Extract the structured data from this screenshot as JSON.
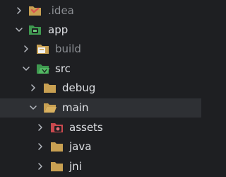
{
  "tree": {
    "items": [
      {
        "label": ".idea",
        "icon": "settings-folder-icon",
        "expanded": false,
        "muted": true
      },
      {
        "label": "app",
        "icon": "module-folder-icon",
        "expanded": true,
        "muted": false
      },
      {
        "label": "build",
        "icon": "build-folder-icon",
        "expanded": false,
        "muted": true
      },
      {
        "label": "src",
        "icon": "source-folder-icon",
        "expanded": true,
        "muted": false
      },
      {
        "label": "debug",
        "icon": "folder-icon",
        "expanded": false,
        "muted": false
      },
      {
        "label": "main",
        "icon": "folder-open-icon",
        "expanded": true,
        "muted": false,
        "selected": true
      },
      {
        "label": "assets",
        "icon": "assets-folder-icon",
        "expanded": false,
        "muted": false
      },
      {
        "label": "java",
        "icon": "folder-icon",
        "expanded": false,
        "muted": false
      },
      {
        "label": "jni",
        "icon": "folder-icon",
        "expanded": false,
        "muted": false
      }
    ]
  },
  "colors": {
    "background": "#1e1f22",
    "selected_row": "#2e3034",
    "text": "#dfe1e5",
    "muted_text": "#8c8f94",
    "folder": "#c8a052",
    "module_green": "#4caf50",
    "assets_red": "#c9494e"
  }
}
